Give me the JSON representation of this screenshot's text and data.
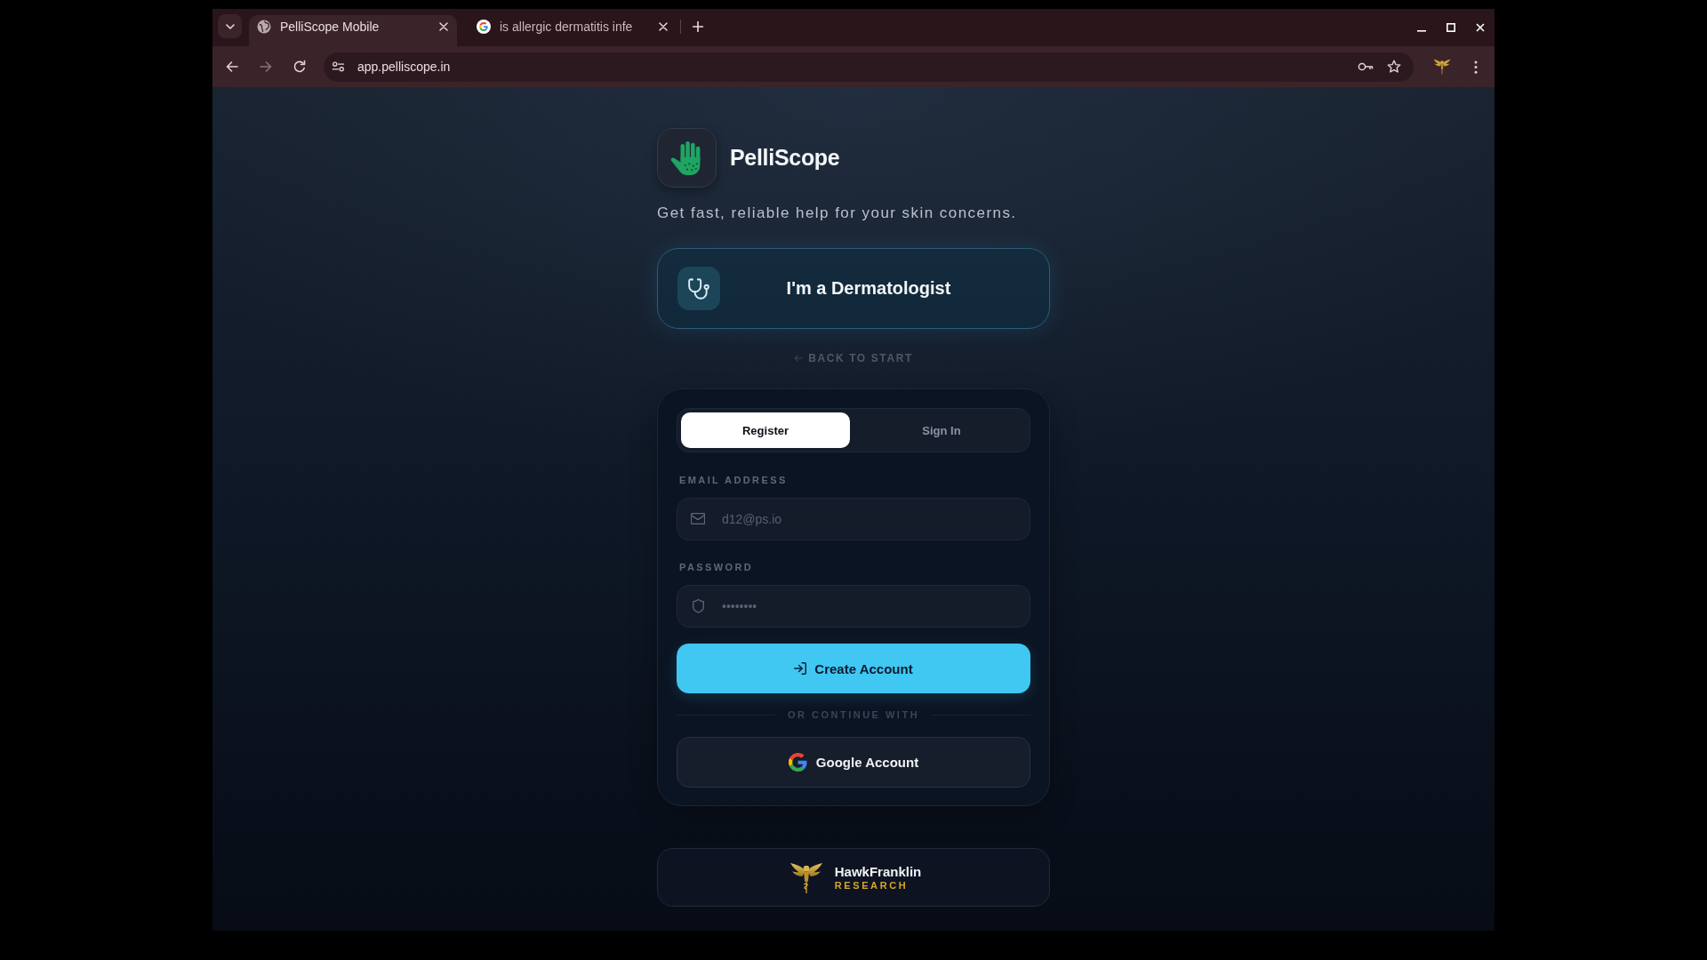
{
  "browser": {
    "tabs": [
      {
        "kind": "globe",
        "title": "PelliScope Mobile",
        "selected": true
      },
      {
        "kind": "google",
        "title": "is allergic dermatitis infe",
        "selected": false
      }
    ],
    "address": "app.pelliscope.in"
  },
  "brand": {
    "name": "PelliScope",
    "tagline": "Get fast, reliable help for your skin concerns."
  },
  "role_button": {
    "label": "I'm a Dermatologist"
  },
  "back_link": {
    "label": "BACK TO START"
  },
  "auth_card": {
    "tabs": [
      {
        "label": "Register",
        "selected": true
      },
      {
        "label": "Sign In",
        "selected": false
      }
    ],
    "fields": [
      {
        "kind": "email",
        "label": "EMAIL ADDRESS",
        "placeholder": "d12@ps.io"
      },
      {
        "kind": "password",
        "label": "PASSWORD",
        "placeholder": "••••••••"
      }
    ],
    "submit_button": {
      "label": "Create Account"
    },
    "divider": {
      "label": "OR CONTINUE WITH"
    },
    "google_button": {
      "label": "Google Account"
    }
  },
  "footer": {
    "name": "HawkFranklin",
    "subtitle": "RESEARCH"
  }
}
